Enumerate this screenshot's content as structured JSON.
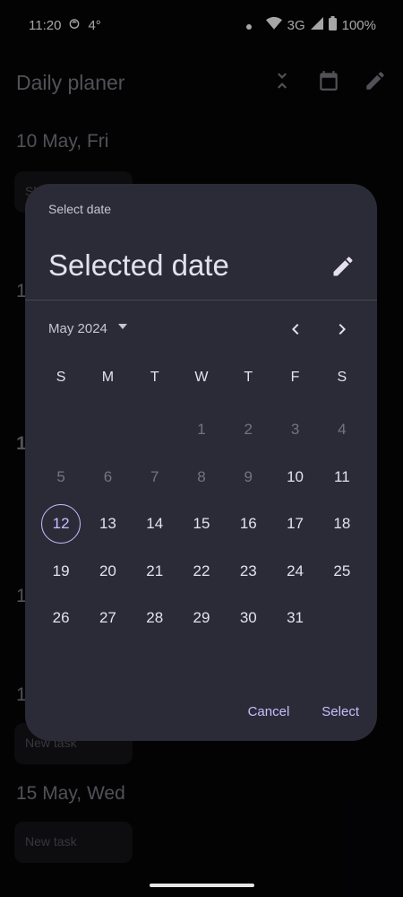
{
  "status_bar": {
    "time": "11:20",
    "temperature": "4°",
    "network": "3G",
    "battery": "100%"
  },
  "app": {
    "title": "Daily planer",
    "days": [
      {
        "header": "10 May, Fri",
        "task": "Sh"
      },
      {
        "header": "1"
      },
      {
        "header": "1"
      },
      {
        "header": "1"
      },
      {
        "header": "1",
        "task": "New task"
      },
      {
        "header": "15 May, Wed",
        "task": "New task"
      }
    ]
  },
  "date_picker": {
    "headline": "Select date",
    "selected_label": "Selected date",
    "month_label": "May 2024",
    "weekdays": [
      "S",
      "M",
      "T",
      "W",
      "T",
      "F",
      "S"
    ],
    "leading_blanks": 3,
    "days_in_month": 31,
    "today": 12,
    "first_enabled_day": 10,
    "cancel_label": "Cancel",
    "select_label": "Select"
  },
  "icons": {
    "collapse": "unfold-less-icon",
    "calendar": "calendar-icon",
    "edit": "pencil-icon",
    "dropdown": "arrow-drop-down-icon",
    "prev": "chevron-left-icon",
    "next": "chevron-right-icon"
  },
  "colors": {
    "dialog_bg": "#2b2b38",
    "accent": "#c4c0ff",
    "app_bg": "#050507"
  }
}
